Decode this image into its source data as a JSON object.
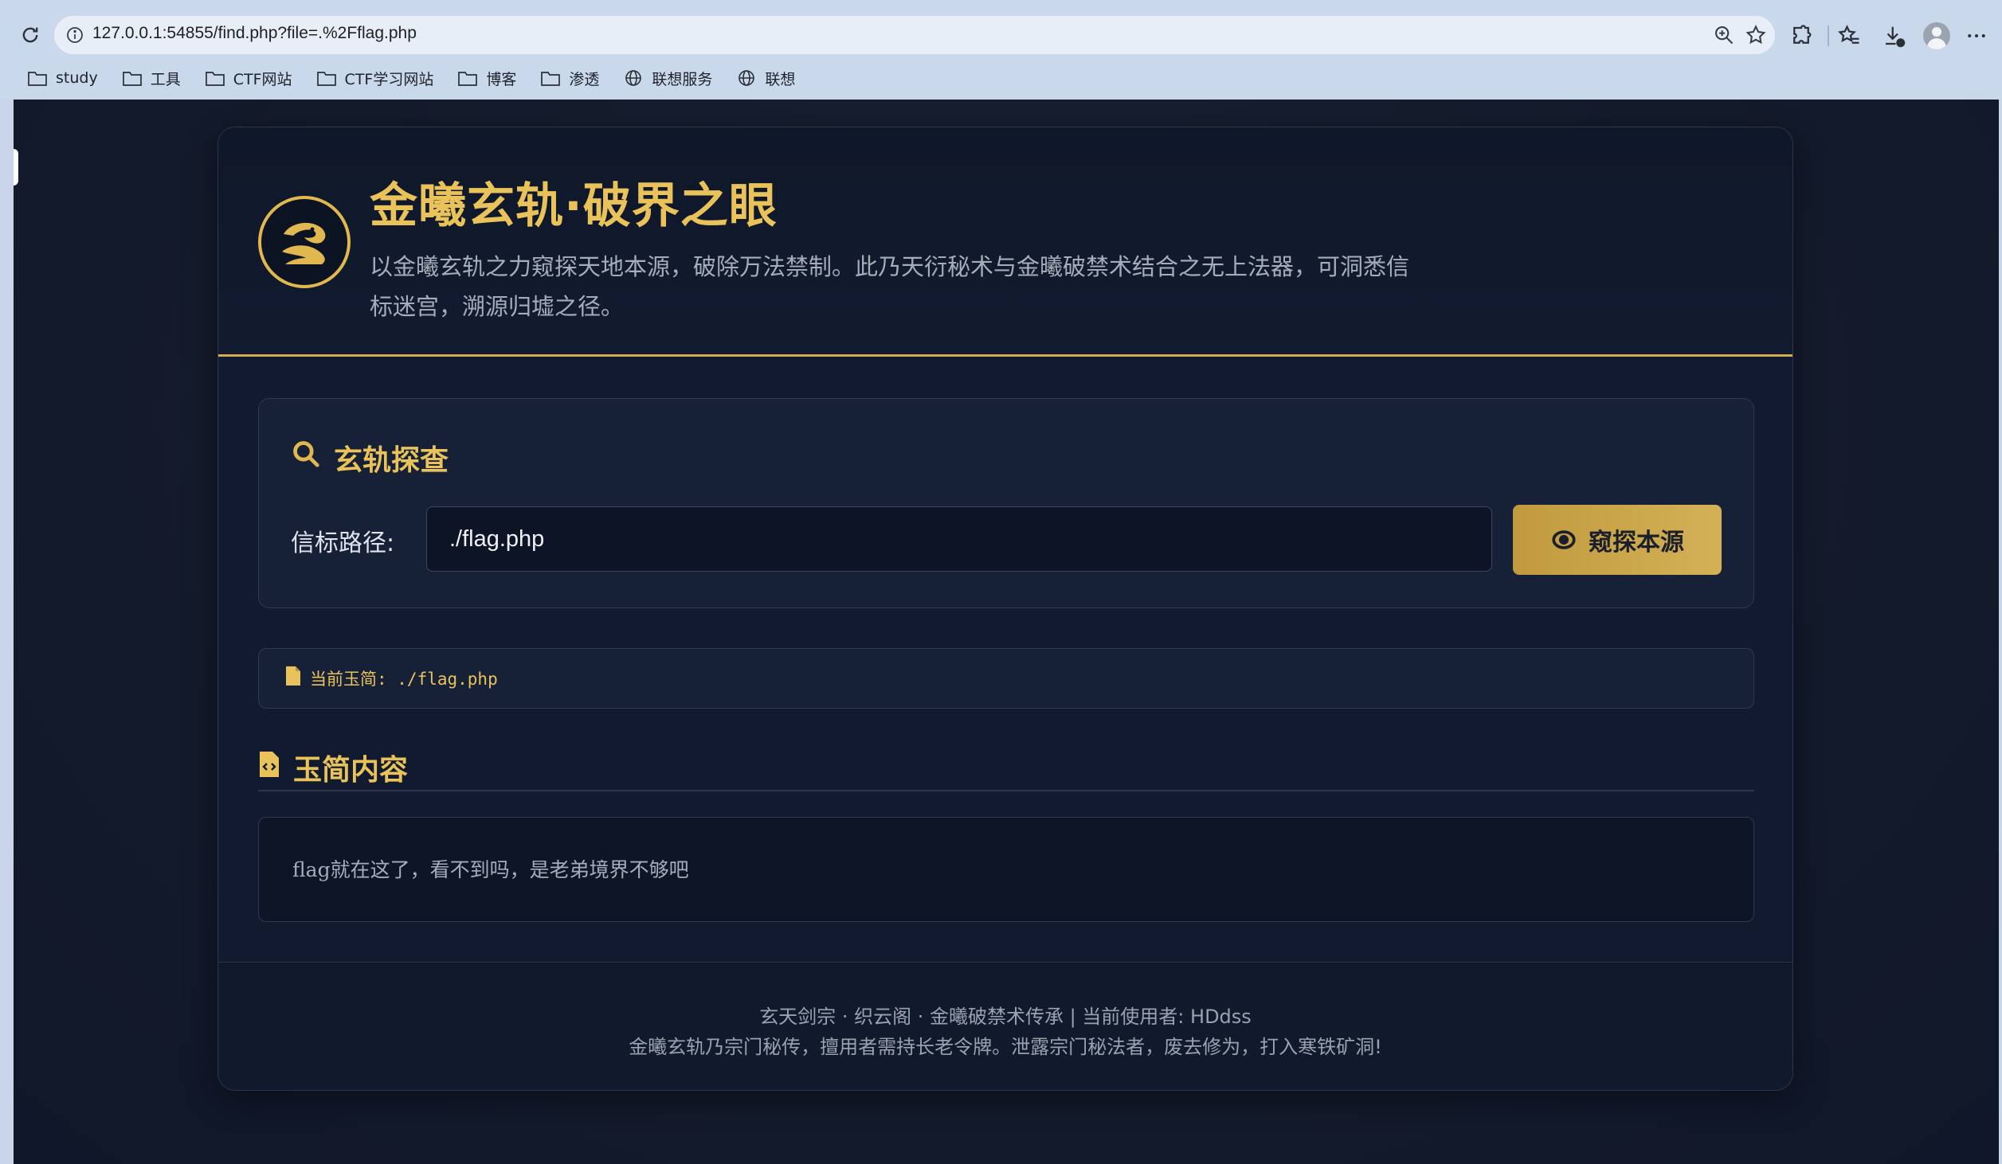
{
  "browser": {
    "url": "127.0.0.1:54855/find.php?file=.%2Fflag.php",
    "bookmarks": [
      {
        "label": "study",
        "icon": "folder-icon"
      },
      {
        "label": "工具",
        "icon": "folder-icon"
      },
      {
        "label": "CTF网站",
        "icon": "folder-icon"
      },
      {
        "label": "CTF学习网站",
        "icon": "folder-icon"
      },
      {
        "label": "博客",
        "icon": "folder-icon"
      },
      {
        "label": "渗透",
        "icon": "folder-icon"
      },
      {
        "label": "联想服务",
        "icon": "globe-icon"
      },
      {
        "label": "联想",
        "icon": "globe-icon"
      }
    ]
  },
  "header": {
    "title": "金曦玄轨·破界之眼",
    "subtitle": "以金曦玄轨之力窥探天地本源，破除万法禁制。此乃天衍秘术与金曦破禁术结合之无上法器，可洞悉信标迷宫，溯源归墟之径。"
  },
  "search": {
    "title": "玄轨探查",
    "label": "信标路径:",
    "value": "./flag.php",
    "button_label": "窥探本源"
  },
  "current": {
    "text": "当前玉简: ./flag.php"
  },
  "content": {
    "title": "玉简内容",
    "body": "flag就在这了，看不到吗，是老弟境界不够吧"
  },
  "footer": {
    "line1": "玄天剑宗 · 织云阁 · 金曦破禁术传承 | 当前使用者: HDdss",
    "line2": "金曦玄轨乃宗门秘传，擅用者需持长老令牌。泄露宗门秘法者，废去修为，打入寒铁矿洞!"
  },
  "colors": {
    "accent": "#e9c35a",
    "button": "#c9a546",
    "background": "#141b2b"
  }
}
